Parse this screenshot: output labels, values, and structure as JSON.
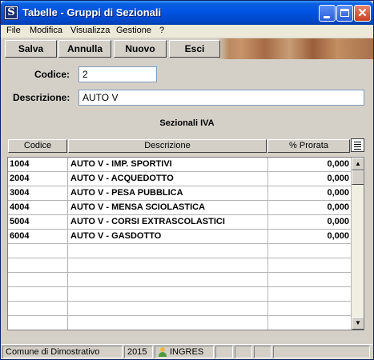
{
  "window": {
    "title": "Tabelle - Gruppi di Sezionali",
    "app_icon_glyph": "S"
  },
  "titlebar_buttons": [
    "minimize-icon",
    "maximize-icon",
    "close-icon"
  ],
  "menu": [
    "File",
    "Modifica",
    "Visualizza",
    "Gestione",
    "?"
  ],
  "toolbar": {
    "buttons": [
      "Salva",
      "Annulla",
      "Nuovo",
      "Esci"
    ]
  },
  "form": {
    "codice_label": "Codice:",
    "codice_value": "2",
    "descrizione_label": "Descrizione:",
    "descrizione_value": "AUTO V"
  },
  "section": {
    "title": "Sezionali IVA"
  },
  "grid": {
    "columns": [
      "Codice",
      "Descrizione",
      "% Prorata"
    ],
    "rows": [
      {
        "codice": "1004",
        "descrizione": "AUTO V - IMP. SPORTIVI",
        "prorata": "0,000"
      },
      {
        "codice": "2004",
        "descrizione": "AUTO V - ACQUEDOTTO",
        "prorata": "0,000"
      },
      {
        "codice": "3004",
        "descrizione": "AUTO V - PESA PUBBLICA",
        "prorata": "0,000"
      },
      {
        "codice": "4004",
        "descrizione": "AUTO V - MENSA SCIOLASTICA",
        "prorata": "0,000"
      },
      {
        "codice": "5004",
        "descrizione": "AUTO V - CORSI EXTRASCOLASTICI",
        "prorata": "0,000"
      },
      {
        "codice": "6004",
        "descrizione": "AUTO V - GASDOTTO",
        "prorata": "0,000"
      }
    ],
    "empty_rows": 6
  },
  "status": {
    "ente": "Comune di Dimostrativo",
    "anno": "2015",
    "utente": "INGRES"
  },
  "colors": {
    "titlebar": "#0054e3",
    "window_face": "#d4d0c8",
    "menubar": "#ece9d8"
  }
}
